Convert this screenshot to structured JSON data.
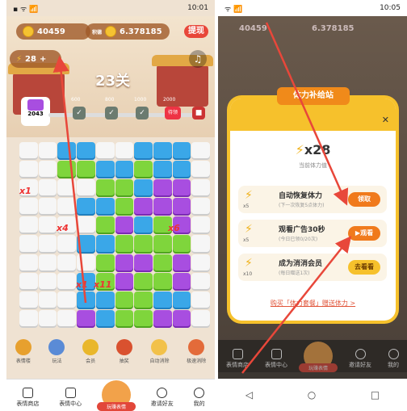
{
  "left": {
    "status": {
      "icons": "▪ ᯤ 📶",
      "time": "10:01"
    },
    "coins": "40459",
    "coin_label": "积德",
    "money": "6.378185",
    "withdraw": "提现",
    "energy": "28",
    "level": "23关",
    "score": "2043",
    "milestones": [
      "600",
      "800",
      "1000",
      "2000"
    ],
    "milestone_badge": "待领",
    "multipliers": [
      {
        "t": "x1"
      },
      {
        "t": "x4"
      },
      {
        "t": "x6"
      },
      {
        "t": "x1"
      },
      {
        "t": "x11"
      }
    ],
    "tools": [
      "表情楼",
      "玩法",
      "会员",
      "抽奖",
      "自动消除",
      "极速消除"
    ],
    "nav": [
      "表情商店",
      "表情中心",
      "玩赚表情",
      "邀请好友",
      "我的"
    ]
  },
  "right": {
    "status": {
      "icons": "ᯤ 📶",
      "time": "10:05"
    },
    "coins": "40459",
    "money": "6.378185",
    "dialog": {
      "title": "体力补给站",
      "amount": "x28",
      "amount_label": "当前体力值",
      "rows": [
        {
          "title": "自动恢复体力",
          "sub": "(下一次恢复5点体力)",
          "badge": "x5",
          "btn": "领取",
          "style": "or"
        },
        {
          "title": "观看广告30秒",
          "sub": "(今日已领0/20次)",
          "badge": "x5",
          "btn": "▶观看",
          "style": "or"
        },
        {
          "title": "成为消消会员",
          "sub": "(每日赠送1次)",
          "badge": "x10",
          "btn": "去看看",
          "style": "ye"
        }
      ],
      "buy_link": "购买「体力套餐」赠送体力 >"
    },
    "nav": [
      "表情商店",
      "表情中心",
      "玩赚表情",
      "邀请好友",
      "我的"
    ],
    "sys": [
      "◁",
      "○",
      "□"
    ]
  },
  "colors": {
    "accent": "#f6c12c",
    "button": "#f07a1c",
    "arrow": "#e8473a"
  }
}
